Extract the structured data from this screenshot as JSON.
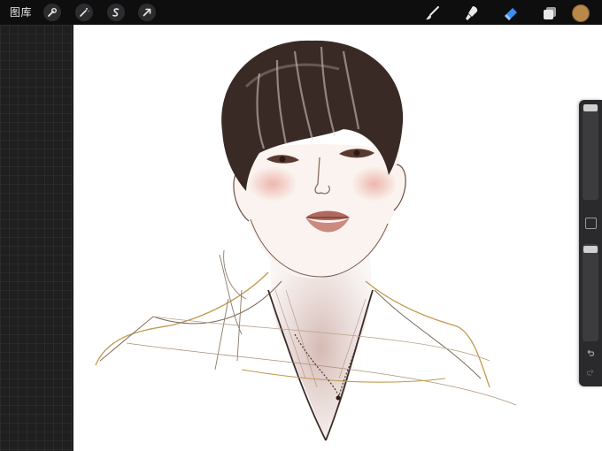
{
  "toolbar": {
    "gallery_label": "图库",
    "left_tools": [
      "wrench-icon",
      "magic-wand-icon",
      "selection-icon",
      "transform-arrow-icon"
    ],
    "right_tools": [
      "brush-icon",
      "smudge-icon",
      "eraser-icon",
      "layers-icon"
    ],
    "active_tool": "eraser-icon",
    "accent_color": "#3b8ef0",
    "current_color": "#b9894a"
  },
  "sidebar": {
    "size_slider_value": 0.95,
    "opacity_slider_value": 1.0,
    "undo_icon": "undo-icon",
    "redo_icon": "redo-icon"
  }
}
